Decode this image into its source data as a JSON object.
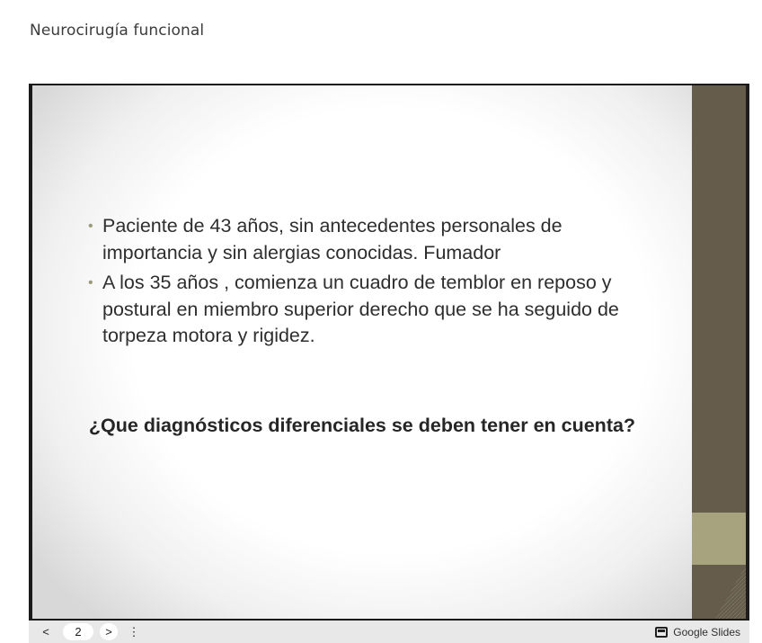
{
  "page": {
    "title": "Neurocirugía funcional"
  },
  "slide": {
    "bullets": [
      "Paciente de 43 años, sin antecedentes personales de importancia y sin alergias conocidas. Fumador",
      "A los 35 años , comienza un cuadro de temblor en reposo y postural en miembro superior derecho que se ha seguido de torpeza motora  y rigidez."
    ],
    "question": "¿Que diagnósticos diferenciales se deben tener en cuenta?"
  },
  "controls": {
    "prev_icon": "chevron-left-icon",
    "prev_glyph": "<",
    "page_number": "2",
    "next_icon": "chevron-right-icon",
    "next_glyph": ">",
    "menu_icon": "more-vertical-icon",
    "menu_glyph": "⋮",
    "brand_icon": "slides-icon",
    "brand_label": "Google Slides"
  },
  "colors": {
    "deco_bar": "#665c4c",
    "deco_square": "#a8a37f",
    "bullet": "#9c9a7c",
    "controls_bg": "#e8e8e8"
  }
}
